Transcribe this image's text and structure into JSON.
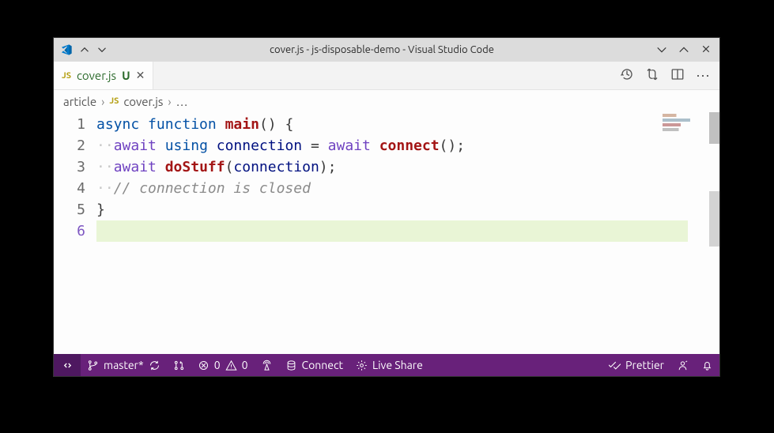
{
  "titlebar": {
    "title": "cover.js - js-disposable-demo - Visual Studio Code"
  },
  "tab": {
    "icon_label": "JS",
    "filename": "cover.js",
    "modified_marker": "U",
    "close_glyph": "✕"
  },
  "editor_actions": {
    "timeline_title": "Open Timeline",
    "changes_title": "Open Changes",
    "split_title": "Split Editor",
    "more_glyph": "⋯"
  },
  "breadcrumb": {
    "segment1": "article",
    "sep": "›",
    "icon_label": "JS",
    "segment2": "cover.js",
    "trailing": "…"
  },
  "code": {
    "line_numbers": [
      "1",
      "2",
      "3",
      "4",
      "5",
      "6"
    ],
    "l1": {
      "kw1": "async",
      "kw2": "function",
      "fn": "main",
      "open": "(",
      "close": ")",
      "brace": "{"
    },
    "l2": {
      "ws": "··",
      "kw1": "await",
      "kw2": "using",
      "ident": "connection",
      "eq": "=",
      "kw3": "await",
      "call": "connect",
      "open": "(",
      "close": ")",
      "semi": ";"
    },
    "l3": {
      "ws": "··",
      "kw1": "await",
      "call": "doStuff",
      "open": "(",
      "ident": "connection",
      "close": ")",
      "semi": ";"
    },
    "l4": {
      "ws": "··",
      "comment": "// connection is closed"
    },
    "l5": {
      "brace": "}"
    }
  },
  "status": {
    "branch": "master*",
    "errors": "0",
    "warnings": "0",
    "connect": "Connect",
    "liveshare": "Live Share",
    "prettier": "Prettier"
  }
}
